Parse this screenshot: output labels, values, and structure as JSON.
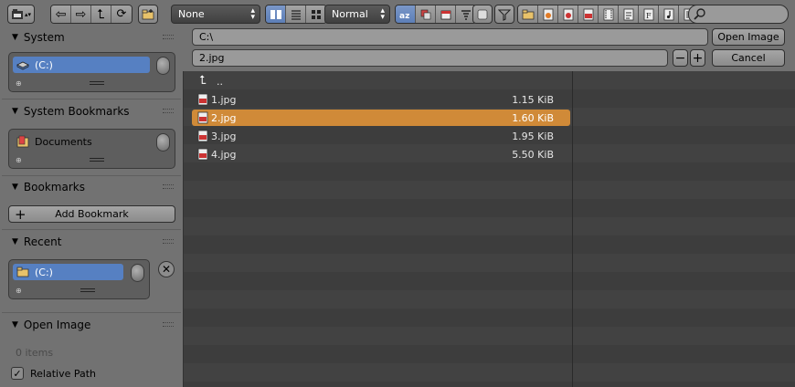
{
  "header": {
    "display_select": "None",
    "sort_select": "Normal"
  },
  "side": {
    "system": {
      "title": "System",
      "items": [
        {
          "label": "(C:)"
        }
      ]
    },
    "system_bookmarks": {
      "title": "System Bookmarks",
      "items": [
        {
          "label": "Documents"
        }
      ]
    },
    "bookmarks": {
      "title": "Bookmarks",
      "add_label": "Add Bookmark"
    },
    "recent": {
      "title": "Recent",
      "items": [
        {
          "label": "(C:)"
        }
      ]
    },
    "open_image": {
      "title": "Open Image",
      "items_count": "0 items",
      "relative_path_label": "Relative Path",
      "relative_path_checked": true
    }
  },
  "pathbar": {
    "directory": "C:\\",
    "filename": "2.jpg",
    "open_label": "Open Image",
    "cancel_label": "Cancel"
  },
  "files": {
    "parent": "..",
    "rows": [
      {
        "name": "1.jpg",
        "size": "1.15 KiB",
        "selected": false
      },
      {
        "name": "2.jpg",
        "size": "1.60 KiB",
        "selected": true
      },
      {
        "name": "3.jpg",
        "size": "1.95 KiB",
        "selected": false
      },
      {
        "name": "4.jpg",
        "size": "5.50 KiB",
        "selected": false
      }
    ]
  },
  "colors": {
    "background": "#727272",
    "selection": "#d08a38",
    "highlight": "#5680c2"
  },
  "icons": [
    "file-browser-icon",
    "back-icon",
    "forward-icon",
    "parent-icon",
    "refresh-icon",
    "new-folder-icon",
    "short-list-icon",
    "detailed-list-icon",
    "thumbnail-icon",
    "sort-alpha-icon",
    "sort-ext-icon",
    "sort-time-icon",
    "sort-size-icon",
    "hidden-icon",
    "filter-icon",
    "folder-icon",
    "image-icon",
    "search-icon",
    "drive-icon",
    "bookmark-icon",
    "close-icon",
    "checkmark-icon"
  ]
}
